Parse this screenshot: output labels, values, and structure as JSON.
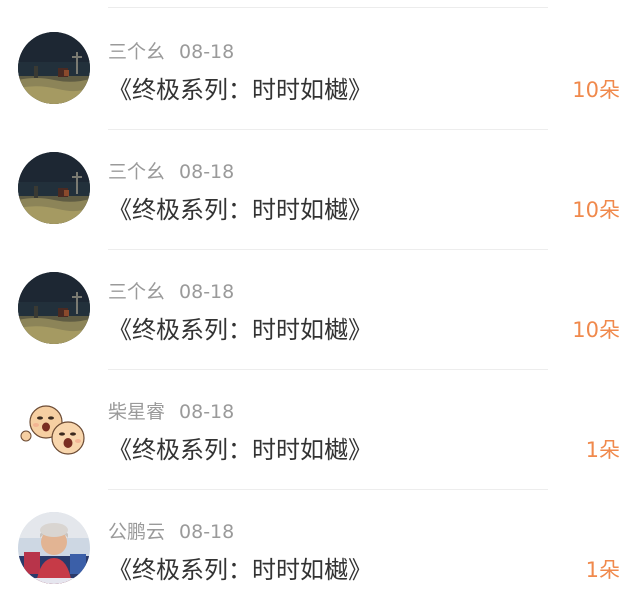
{
  "comments": [
    {
      "user": "三个幺",
      "date": "08-18",
      "text": "《终极系列：时时如樾》",
      "flowers": "10朵",
      "avatar": "dark-scene-avatar"
    },
    {
      "user": "三个幺",
      "date": "08-18",
      "text": "《终极系列：时时如樾》",
      "flowers": "10朵",
      "avatar": "dark-scene-avatar"
    },
    {
      "user": "三个幺",
      "date": "08-18",
      "text": "《终极系列：时时如樾》",
      "flowers": "10朵",
      "avatar": "dark-scene-avatar"
    },
    {
      "user": "柴星睿",
      "date": "08-18",
      "text": "《终极系列：时时如樾》",
      "flowers": "1朵",
      "avatar": "cartoon-faces-avatar"
    },
    {
      "user": "公鹏云",
      "date": "08-18",
      "text": "《终极系列：时时如樾》",
      "flowers": "1朵",
      "avatar": "portrait-photo-avatar"
    }
  ],
  "colors": {
    "username": "#9a9a9a",
    "text": "#333333",
    "flowers": "#f0894c",
    "divider": "#ededed"
  }
}
